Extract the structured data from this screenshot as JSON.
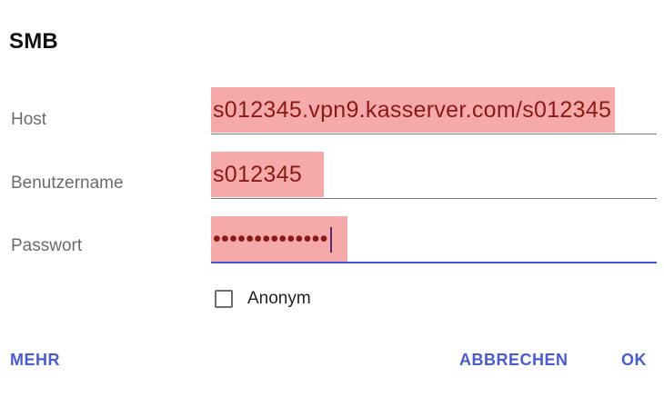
{
  "dialog": {
    "title": "SMB"
  },
  "form": {
    "host": {
      "label": "Host",
      "value": "s012345.vpn9.kasserver.com/s012345"
    },
    "username": {
      "label": "Benutzername",
      "value": "s012345"
    },
    "password": {
      "label": "Passwort",
      "value": "••••••••••••••"
    },
    "anonymous": {
      "label": "Anonym",
      "checked": false
    }
  },
  "buttons": {
    "more": "MEHR",
    "cancel": "ABBRECHEN",
    "ok": "OK"
  },
  "colors": {
    "accent": "#4a5bd8",
    "highlight": "#f5a9a9"
  }
}
